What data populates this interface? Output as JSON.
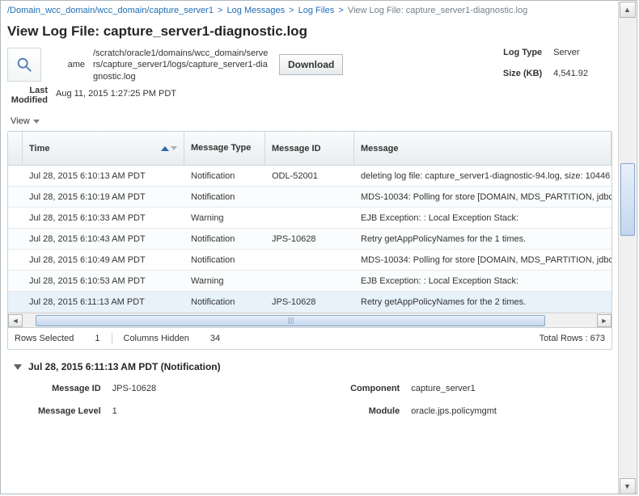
{
  "breadcrumb": {
    "items": [
      {
        "label": "/Domain_wcc_domain/wcc_domain/capture_server1"
      },
      {
        "label": "Log Messages"
      },
      {
        "label": "Log Files"
      }
    ],
    "leaf": "View Log File: capture_server1-diagnostic.log"
  },
  "title": "View Log File: capture_server1-diagnostic.log",
  "meta": {
    "name_label": "ame",
    "name_value": "/scratch/oracle1/domains/wcc_domain/servers/capture_server1/logs/capture_server1-diagnostic.log",
    "download_label": "Download",
    "log_type_label": "Log Type",
    "log_type_value": "Server",
    "size_label": "Size (KB)",
    "size_value": "4,541.92",
    "last_modified_label": "Last Modified",
    "last_modified_value": "Aug 11, 2015 1:27:25 PM PDT"
  },
  "view_menu_label": "View",
  "table": {
    "headers": {
      "time": "Time",
      "type": "Message Type",
      "msgid": "Message ID",
      "msg": "Message"
    },
    "rows": [
      {
        "time": "Jul 28, 2015 6:10:13 AM PDT",
        "type": "Notification",
        "msgid": "ODL-52001",
        "msg": "deleting log file: capture_server1-diagnostic-94.log, size: 10446"
      },
      {
        "time": "Jul 28, 2015 6:10:19 AM PDT",
        "type": "Notification",
        "msgid": "",
        "msg": "MDS-10034: Polling for store [DOMAIN, MDS_PARTITION, jdbc/"
      },
      {
        "time": "Jul 28, 2015 6:10:33 AM PDT",
        "type": "Warning",
        "msgid": "",
        "msg": "EJB Exception: : Local Exception Stack:"
      },
      {
        "time": "Jul 28, 2015 6:10:43 AM PDT",
        "type": "Notification",
        "msgid": "JPS-10628",
        "msg": "Retry getAppPolicyNames for the 1 times."
      },
      {
        "time": "Jul 28, 2015 6:10:49 AM PDT",
        "type": "Notification",
        "msgid": "",
        "msg": "MDS-10034: Polling for store [DOMAIN, MDS_PARTITION, jdbc/"
      },
      {
        "time": "Jul 28, 2015 6:10:53 AM PDT",
        "type": "Warning",
        "msgid": "",
        "msg": "EJB Exception: : Local Exception Stack:"
      },
      {
        "time": "Jul 28, 2015 6:11:13 AM PDT",
        "type": "Notification",
        "msgid": "JPS-10628",
        "msg": "Retry getAppPolicyNames for the 2 times."
      }
    ]
  },
  "summary": {
    "rows_selected_label": "Rows Selected",
    "rows_selected_value": "1",
    "columns_hidden_label": "Columns Hidden",
    "columns_hidden_value": "34",
    "total_rows_label": "Total Rows",
    "total_rows_value": "673"
  },
  "detail": {
    "header": "Jul 28, 2015 6:11:13 AM PDT (Notification)",
    "msgid_label": "Message ID",
    "msgid_value": "JPS-10628",
    "level_label": "Message Level",
    "level_value": "1",
    "component_label": "Component",
    "component_value": "capture_server1",
    "module_label": "Module",
    "module_value": "oracle.jps.policymgmt"
  }
}
